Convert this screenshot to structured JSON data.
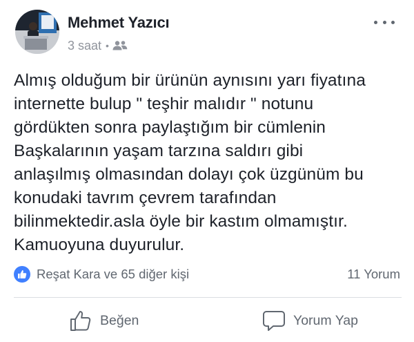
{
  "post": {
    "author": "Mehmet Yazıcı",
    "time": "3 saat",
    "meta_separator": "•",
    "audience_icon": "friends-icon",
    "text": "Almış olduğum bir ürünün aynısını yarı fiyatına\ninternette bulup \" teşhir malıdır \" notunu\ngördükten sonra paylaştığım  bir cümlenin\nBaşkalarının yaşam tarzına saldırı gibi\nanlaşılmış olmasından dolayı çok üzgünüm bu\nkonudaki tavrım çevrem tarafından\nbilinmektedir.asla öyle bir kastım olmamıştır.\nKamuoyuna duyurulur."
  },
  "reactions": {
    "summary": "Reşat Kara ve 65 diğer kişi",
    "comments": "11 Yorum",
    "badge_color": "#4080ff"
  },
  "actions": {
    "like_label": "Beğen",
    "comment_label": "Yorum Yap"
  },
  "colors": {
    "text": "#1d2129",
    "secondary": "#606770",
    "meta": "#90949c",
    "divider": "#dadde1"
  }
}
